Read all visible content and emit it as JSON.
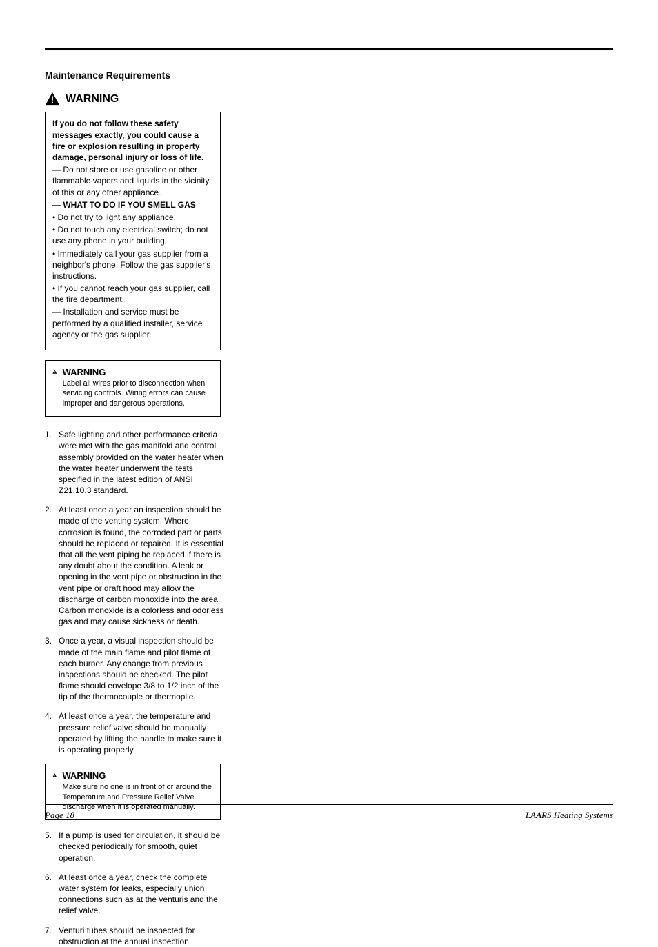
{
  "heading": "Maintenance Requirements",
  "warning_label": "WARNING",
  "safety_box": {
    "intro_bold": "If you do not follow these safety messages exactly, you could cause a fire or explosion resulting in property damage, personal injury or loss of life.",
    "bullet1": "— Do not store or use gasoline or other flammable vapors and liquids in the vicinity of this or any other appliance.",
    "what_to_do_label": "— WHAT TO DO IF YOU SMELL GAS",
    "do1": "• Do not try to light any appliance.",
    "do2": "• Do not touch any electrical switch; do not use any phone in your building.",
    "do3": "• Immediately call your gas supplier from a neighbor's phone. Follow the gas supplier's instructions.",
    "do4": "• If you cannot reach your gas supplier, call the fire department.",
    "closing": "— Installation and service must be performed by a qualified installer, service agency or the gas supplier."
  },
  "box_warning": {
    "label": "WARNING",
    "body": "Label all wires prior to disconnection when servicing controls. Wiring errors can cause improper and dangerous operations."
  },
  "steps": {
    "s1_num": "1.",
    "s1": "Safe lighting and other performance criteria were met with the gas manifold and control assembly provided on the water heater when the water heater underwent the tests specified in the latest edition of ANSI Z21.10.3 standard.",
    "s2_num": "2.",
    "s2": "At least once a year an inspection should be made of the venting system. Where corrosion is found, the corroded part or parts should be replaced or repaired. It is essential that all the vent piping be replaced if there is any doubt about the condition. A leak or opening in the vent pipe or obstruction in the vent pipe or draft hood may allow the discharge of carbon monoxide into the area. Carbon monoxide is a colorless and odorless gas and may cause sickness or death.",
    "s3_num": "3.",
    "s3": "Once a year, a visual inspection should be made of the main flame and pilot flame of each burner. Any change from previous inspections should be checked. The pilot flame should envelope 3/8 to 1/2 inch of the tip of the thermocouple or thermopile.",
    "s4_num": "4.",
    "s4": "At least once a year, the temperature and pressure relief valve should be manually operated by lifting the handle to make sure it is operating properly.",
    "s5_num": "5.",
    "s5": "If a pump is used for circulation, it should be checked periodically for smooth, quiet operation.",
    "s6_num": "6.",
    "s6": "At least once a year, check the complete water system for leaks, especially union connections such as at the venturis and the relief valve.",
    "s7_num": "7.",
    "s7": "Venturi tubes should be inspected for obstruction at the annual inspection."
  },
  "step_warning": {
    "label": "WARNING",
    "body": "Make sure no one is in front of or around the Temperature and Pressure Relief Valve discharge when it is operated manually."
  },
  "footer": {
    "left": "Page 18",
    "right": "LAARS Heating Systems"
  }
}
